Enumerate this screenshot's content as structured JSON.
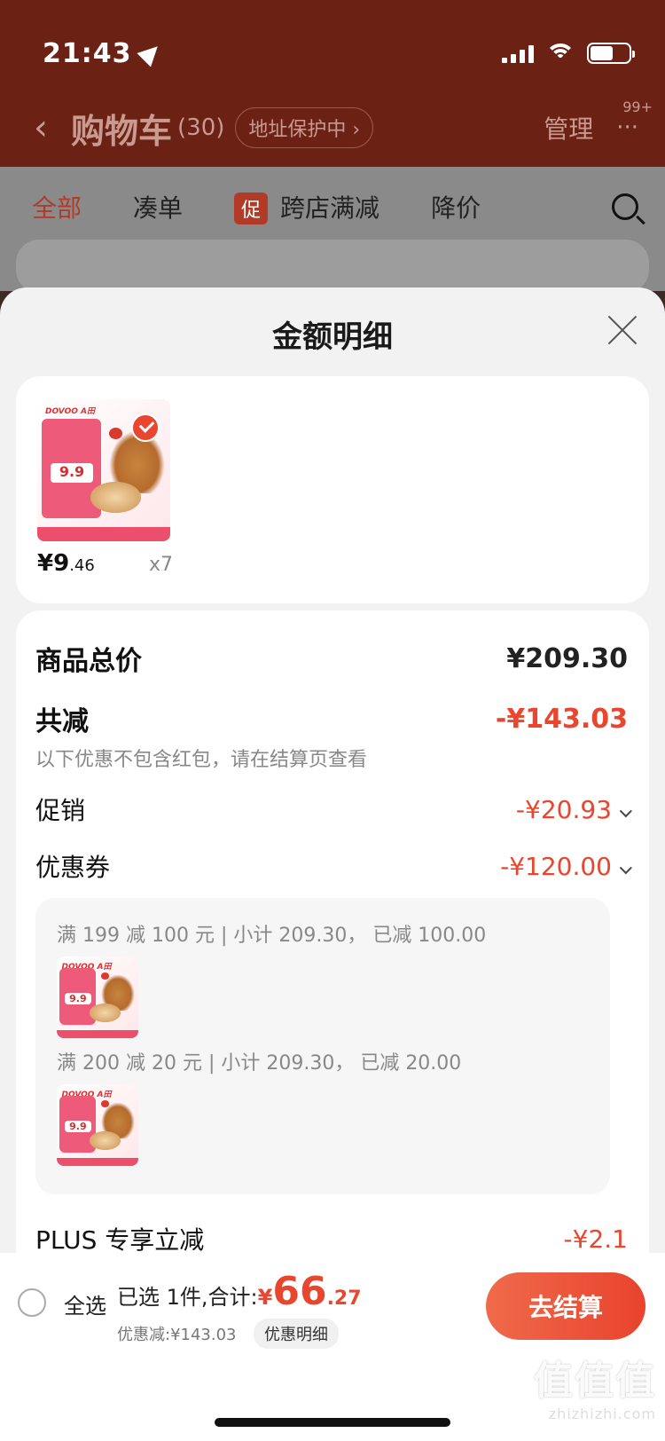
{
  "status_bar": {
    "time": "21:43"
  },
  "background_app": {
    "nav": {
      "back": "‹",
      "title": "购物车",
      "count": "(30)",
      "address": "地址保护中 ›",
      "manage": "管理",
      "more": "···",
      "more_badge": "99+"
    },
    "tabs": [
      "全部",
      "凑单",
      "跨店满减",
      "降价"
    ],
    "promo_badge": "促"
  },
  "sheet": {
    "title": "金额明细",
    "item": {
      "brand": "DOVOO A田",
      "price_main": "¥9",
      "price_decimal": ".46",
      "quantity": "x7",
      "badge_price": "9.9"
    },
    "rows": {
      "total_label": "商品总价",
      "total_value": "¥209.30",
      "reduce_label": "共减",
      "reduce_value": "-¥143.03",
      "note": "以下优惠不包含红包，请在结算页查看",
      "promo_label": "促销",
      "promo_value": "-¥20.93",
      "coupon_label": "优惠券",
      "coupon_value": "-¥120.00",
      "plus_label": "PLUS 专享立减",
      "plus_value": "-¥2.1"
    },
    "coupons": [
      {
        "desc": "满 199 减 100 元 | 小计 209.30， 已减 100.00"
      },
      {
        "desc": "满 200 减 20 元 | 小计 209.30， 已减 20.00"
      }
    ]
  },
  "bottom_bar": {
    "select_all": "全选",
    "summary_label": "已选 1件,合计:",
    "currency": "¥",
    "total_int": "66",
    "total_dec": ".27",
    "discount": "优惠减:¥143.03",
    "detail_link": "优惠明细",
    "checkout": "去结算"
  },
  "watermark": {
    "big": "值值值",
    "small": "zhizhizhi.com"
  },
  "colors": {
    "accent": "#e8462f",
    "header_bg": "#6b2114"
  }
}
